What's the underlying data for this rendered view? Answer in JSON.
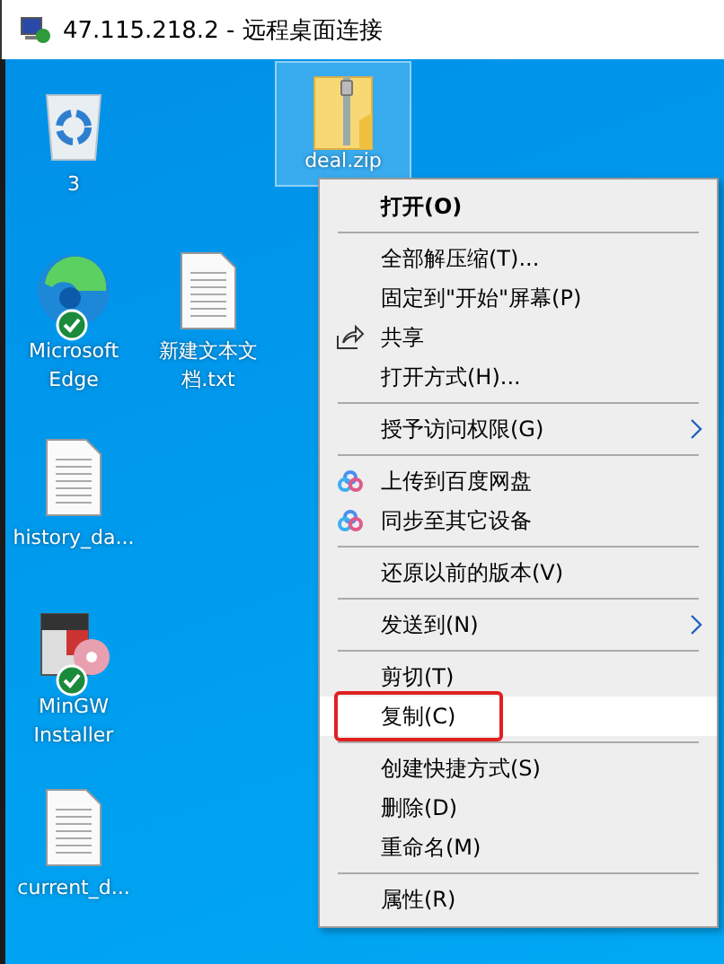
{
  "window": {
    "title": "47.115.218.2 - 远程桌面连接"
  },
  "desktop_icons": [
    {
      "kind": "recycle-bin",
      "label": "3",
      "selected": false,
      "badge": false
    },
    {
      "kind": "zip",
      "label": "deal.zip",
      "selected": true,
      "badge": false
    },
    {
      "kind": "browser",
      "label": "Microsoft Edge",
      "selected": false,
      "badge": true
    },
    {
      "kind": "text",
      "label": "新建文本文档.txt",
      "selected": false,
      "badge": false
    },
    {
      "kind": "text",
      "label": "history_da...",
      "selected": false,
      "badge": false
    },
    {
      "kind": "installer",
      "label": "MinGW Installer",
      "selected": false,
      "badge": true
    },
    {
      "kind": "text",
      "label": "current_d...",
      "selected": false,
      "badge": false
    }
  ],
  "context_menu": [
    {
      "kind": "item",
      "label": "打开(O)",
      "default": true,
      "submenu": false,
      "selected": false,
      "marked": false
    },
    {
      "kind": "separator"
    },
    {
      "kind": "item",
      "label": "全部解压缩(T)...",
      "default": false,
      "submenu": false,
      "selected": false,
      "marked": false
    },
    {
      "kind": "item",
      "label": "固定到\"开始\"屏幕(P)",
      "default": false,
      "submenu": false,
      "selected": false,
      "marked": false
    },
    {
      "kind": "share",
      "label": "共享",
      "default": false,
      "submenu": false,
      "selected": false,
      "marked": false
    },
    {
      "kind": "item",
      "label": "打开方式(H)...",
      "default": false,
      "submenu": false,
      "selected": false,
      "marked": false
    },
    {
      "kind": "separator"
    },
    {
      "kind": "item",
      "label": "授予访问权限(G)",
      "default": false,
      "submenu": true,
      "selected": false,
      "marked": false
    },
    {
      "kind": "separator"
    },
    {
      "kind": "cloud",
      "label": "上传到百度网盘",
      "default": false,
      "submenu": false,
      "selected": false,
      "marked": false
    },
    {
      "kind": "cloud",
      "label": "同步至其它设备",
      "default": false,
      "submenu": false,
      "selected": false,
      "marked": false
    },
    {
      "kind": "separator"
    },
    {
      "kind": "item",
      "label": "还原以前的版本(V)",
      "default": false,
      "submenu": false,
      "selected": false,
      "marked": false
    },
    {
      "kind": "separator"
    },
    {
      "kind": "item",
      "label": "发送到(N)",
      "default": false,
      "submenu": true,
      "selected": false,
      "marked": false
    },
    {
      "kind": "separator"
    },
    {
      "kind": "item",
      "label": "剪切(T)",
      "default": false,
      "submenu": false,
      "selected": false,
      "marked": false
    },
    {
      "kind": "item",
      "label": "复制(C)",
      "default": false,
      "submenu": false,
      "selected": true,
      "marked": true
    },
    {
      "kind": "separator"
    },
    {
      "kind": "item",
      "label": "创建快捷方式(S)",
      "default": false,
      "submenu": false,
      "selected": false,
      "marked": false
    },
    {
      "kind": "item",
      "label": "删除(D)",
      "default": false,
      "submenu": false,
      "selected": false,
      "marked": false
    },
    {
      "kind": "item",
      "label": "重命名(M)",
      "default": false,
      "submenu": false,
      "selected": false,
      "marked": false
    },
    {
      "kind": "separator"
    },
    {
      "kind": "item",
      "label": "属性(R)",
      "default": false,
      "submenu": false,
      "selected": false,
      "marked": false
    }
  ]
}
